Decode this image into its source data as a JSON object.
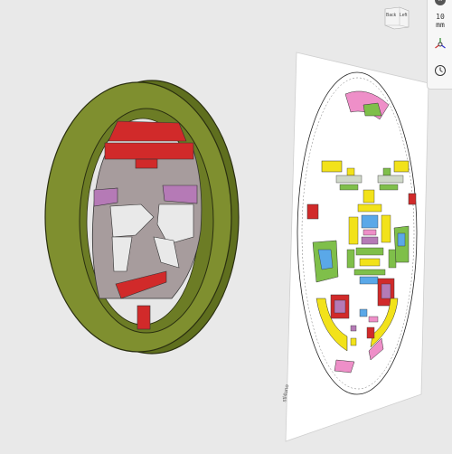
{
  "view_cube": {
    "faces": [
      "Back",
      "Left"
    ]
  },
  "toolbar": {
    "zoom": {
      "value": "10",
      "unit": "mm"
    }
  },
  "drawing": {
    "brand_mark": "stl4uno"
  },
  "colors": {
    "background": "#e9e9e9",
    "ring": "#7f8f2f",
    "ring_dark": "#5f6f1e",
    "face_plate": "#a79c9d",
    "red": "#d12a2a",
    "purple": "#b57ab6",
    "yellow": "#f2e21a",
    "green": "#7fbf4a",
    "blue": "#5aa8e8",
    "pink": "#ee8fc8"
  },
  "icons": [
    "compass-icon",
    "axes-icon",
    "history-icon"
  ]
}
